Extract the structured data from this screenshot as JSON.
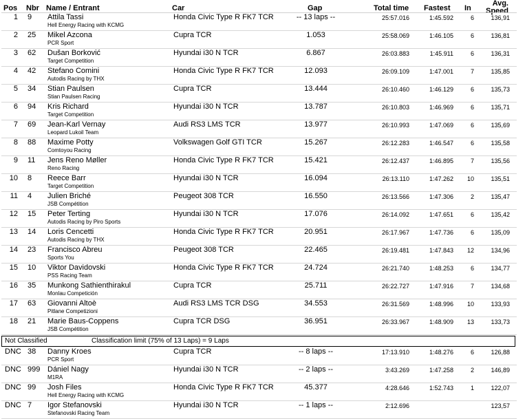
{
  "headers": {
    "pos": "Pos",
    "nbr": "Nbr",
    "name": "Name / Entrant",
    "car": "Car",
    "gap": "Gap",
    "total_time": "Total time",
    "fastest": "Fastest",
    "in": "In",
    "avg_speed_line1": "Avg.",
    "avg_speed_line2": "Speed"
  },
  "classified": [
    {
      "pos": "1",
      "nbr": "9",
      "name": "Attila Tassi",
      "team": "Hell Energy Racing with KCMG",
      "car": "Honda Civic Type R FK7 TCR",
      "gap": "-- 13 laps --",
      "total_time": "25:57.016",
      "fastest": "1:45.592",
      "in": "6",
      "speed": "136,91"
    },
    {
      "pos": "2",
      "nbr": "25",
      "name": "Mikel Azcona",
      "team": "PCR Sport",
      "car": "Cupra TCR",
      "gap": "1.053",
      "total_time": "25:58.069",
      "fastest": "1:46.105",
      "in": "6",
      "speed": "136,81"
    },
    {
      "pos": "3",
      "nbr": "62",
      "name": "Dušan Borković",
      "team": "Target Competition",
      "car": "Hyundai i30 N TCR",
      "gap": "6.867",
      "total_time": "26:03.883",
      "fastest": "1:45.911",
      "in": "6",
      "speed": "136,31"
    },
    {
      "pos": "4",
      "nbr": "42",
      "name": "Stefano Comini",
      "team": "Autodis Racing by THX",
      "car": "Honda Civic Type R FK7 TCR",
      "gap": "12.093",
      "total_time": "26:09.109",
      "fastest": "1:47.001",
      "in": "7",
      "speed": "135,85"
    },
    {
      "pos": "5",
      "nbr": "34",
      "name": "Stian Paulsen",
      "team": "Stian Paulsen Racing",
      "car": "Cupra TCR",
      "gap": "13.444",
      "total_time": "26:10.460",
      "fastest": "1:46.129",
      "in": "6",
      "speed": "135,73"
    },
    {
      "pos": "6",
      "nbr": "94",
      "name": "Kris Richard",
      "team": "Target Competition",
      "car": "Hyundai i30 N TCR",
      "gap": "13.787",
      "total_time": "26:10.803",
      "fastest": "1:46.969",
      "in": "6",
      "speed": "135,71"
    },
    {
      "pos": "7",
      "nbr": "69",
      "name": "Jean-Karl Vernay",
      "team": "Leopard Lukoil Team",
      "car": "Audi RS3 LMS TCR",
      "gap": "13.977",
      "total_time": "26:10.993",
      "fastest": "1:47.069",
      "in": "6",
      "speed": "135,69"
    },
    {
      "pos": "8",
      "nbr": "88",
      "name": "Maxime Potty",
      "team": "Comtoyou Racing",
      "car": "Volkswagen Golf GTI TCR",
      "gap": "15.267",
      "total_time": "26:12.283",
      "fastest": "1:46.547",
      "in": "6",
      "speed": "135,58"
    },
    {
      "pos": "9",
      "nbr": "11",
      "name": "Jens Reno Møller",
      "team": "Reno Racing",
      "car": "Honda Civic Type R FK7 TCR",
      "gap": "15.421",
      "total_time": "26:12.437",
      "fastest": "1:46.895",
      "in": "7",
      "speed": "135,56"
    },
    {
      "pos": "10",
      "nbr": "8",
      "name": "Reece Barr",
      "team": "Target Competition",
      "car": "Hyundai i30 N TCR",
      "gap": "16.094",
      "total_time": "26:13.110",
      "fastest": "1:47.262",
      "in": "10",
      "speed": "135,51"
    },
    {
      "pos": "11",
      "nbr": "4",
      "name": "Julien Briché",
      "team": "JSB Compétition",
      "car": "Peugeot 308 TCR",
      "gap": "16.550",
      "total_time": "26:13.566",
      "fastest": "1:47.306",
      "in": "2",
      "speed": "135,47"
    },
    {
      "pos": "12",
      "nbr": "15",
      "name": "Peter Terting",
      "team": "Autodis Racing by Piro Sports",
      "car": "Hyundai i30 N TCR",
      "gap": "17.076",
      "total_time": "26:14.092",
      "fastest": "1:47.651",
      "in": "6",
      "speed": "135,42"
    },
    {
      "pos": "13",
      "nbr": "14",
      "name": "Loris Cencetti",
      "team": "Autodis Racing by THX",
      "car": "Honda Civic Type R FK7 TCR",
      "gap": "20.951",
      "total_time": "26:17.967",
      "fastest": "1:47.736",
      "in": "6",
      "speed": "135,09"
    },
    {
      "pos": "14",
      "nbr": "23",
      "name": "Francisco Abreu",
      "team": "Sports You",
      "car": "Peugeot 308 TCR",
      "gap": "22.465",
      "total_time": "26:19.481",
      "fastest": "1:47.843",
      "in": "12",
      "speed": "134,96"
    },
    {
      "pos": "15",
      "nbr": "10",
      "name": "Viktor Davidovski",
      "team": "PSS Racing Team",
      "car": "Honda Civic Type R FK7 TCR",
      "gap": "24.724",
      "total_time": "26:21.740",
      "fastest": "1:48.253",
      "in": "6",
      "speed": "134,77"
    },
    {
      "pos": "16",
      "nbr": "35",
      "name": "Munkong Sathienthirakul",
      "team": "Monlau Competición",
      "car": "Cupra TCR",
      "gap": "25.711",
      "total_time": "26:22.727",
      "fastest": "1:47.916",
      "in": "7",
      "speed": "134,68"
    },
    {
      "pos": "17",
      "nbr": "63",
      "name": "Giovanni Altoè",
      "team": "Pitlane Competizioni",
      "car": "Audi RS3 LMS TCR DSG",
      "gap": "34.553",
      "total_time": "26:31.569",
      "fastest": "1:48.996",
      "in": "10",
      "speed": "133,93"
    },
    {
      "pos": "18",
      "nbr": "21",
      "name": "Marie Baus-Coppens",
      "team": "JSB Compétition",
      "car": "Cupra TCR DSG",
      "gap": "36.951",
      "total_time": "26:33.967",
      "fastest": "1:48.909",
      "in": "13",
      "speed": "133,73"
    }
  ],
  "not_classified": {
    "label": "Not Classified",
    "limit_text": "Classification limit (75% of 13 Laps) = 9 Laps"
  },
  "dnc": [
    {
      "pos": "DNC",
      "nbr": "38",
      "name": "Danny Kroes",
      "team": "PCR Sport",
      "car": "Cupra TCR",
      "gap": "-- 8 laps --",
      "total_time": "17:13.910",
      "fastest": "1:48.276",
      "in": "6",
      "speed": "126,88"
    },
    {
      "pos": "DNC",
      "nbr": "999",
      "name": "Dániel Nagy",
      "team": "M1RA",
      "car": "Hyundai i30 N TCR",
      "gap": "-- 2 laps --",
      "total_time": "3:43.269",
      "fastest": "1:47.258",
      "in": "2",
      "speed": "146,89"
    },
    {
      "pos": "DNC",
      "nbr": "99",
      "name": "Josh Files",
      "team": "Hell Energy Racing with KCMG",
      "car": "Honda Civic Type R FK7 TCR",
      "gap": "45.377",
      "total_time": "4:28.646",
      "fastest": "1:52.743",
      "in": "1",
      "speed": "122,07"
    },
    {
      "pos": "DNC",
      "nbr": "7",
      "name": "Igor Stefanovski",
      "team": "Stefanovski Racing Team",
      "car": "Hyundai i30 N TCR",
      "gap": "-- 1 laps --",
      "total_time": "2:12.696",
      "fastest": "",
      "in": "",
      "speed": "123,57"
    }
  ]
}
